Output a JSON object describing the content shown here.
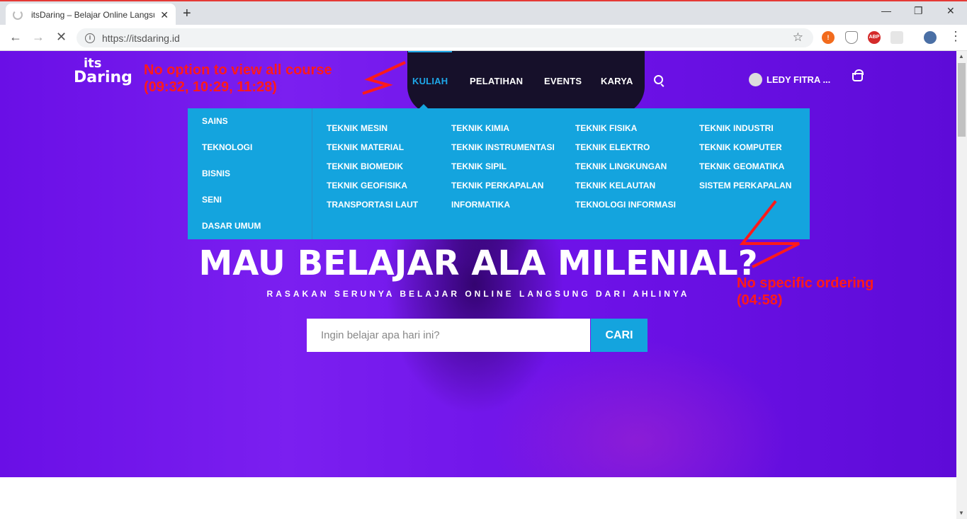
{
  "browser": {
    "tab_title": "itsDaring – Belajar Online Langsung",
    "url": "https://itsdaring.id",
    "new_tab": "+",
    "tab_close": "✕",
    "minimize": "—",
    "maximize": "❐",
    "close": "✕",
    "back": "←",
    "forward": "→",
    "stop": "✕",
    "star": "☆",
    "menu": "⋮",
    "ext_abp": "ABP",
    "ext_alert": "!"
  },
  "site": {
    "logo_line1": "its",
    "logo_line2": "Daring",
    "nav": [
      "KULIAH",
      "PELATIHAN",
      "EVENTS",
      "KARYA"
    ],
    "user_name": "LEDY FITRA ...",
    "categories": [
      "SAINS",
      "TEKNOLOGI",
      "BISNIS",
      "SENI",
      "DASAR UMUM"
    ],
    "subcategories": {
      "col1": [
        "TEKNIK MESIN",
        "TEKNIK MATERIAL",
        "TEKNIK BIOMEDIK",
        "TEKNIK GEOFISIKA",
        "TRANSPORTASI LAUT"
      ],
      "col2": [
        "TEKNIK KIMIA",
        "TEKNIK INSTRUMENTASI",
        "TEKNIK SIPIL",
        "TEKNIK PERKAPALAN",
        "INFORMATIKA"
      ],
      "col3": [
        "TEKNIK FISIKA",
        "TEKNIK ELEKTRO",
        "TEKNIK LINGKUNGAN",
        "TEKNIK KELAUTAN",
        "TEKNOLOGI INFORMASI"
      ],
      "col4": [
        "TEKNIK INDUSTRI",
        "TEKNIK KOMPUTER",
        "TEKNIK GEOMATIKA",
        "SISTEM PERKAPALAN"
      ]
    },
    "hero_title": "MAU BELAJAR ALA MILENIAL?",
    "hero_subtitle": "RASAKAN SERUNYA BELAJAR ONLINE LANGSUNG DARI AHLINYA",
    "search_placeholder": "Ingin belajar apa hari ini?",
    "search_button": "CARI"
  },
  "annotations": {
    "note1_line1": "No option to view all course",
    "note1_line2": "(09:32, 10:29, 11:28)",
    "note2_line1": "No specific ordering",
    "note2_line2": "(04:58)",
    "color": "#ff1a1a"
  },
  "colors": {
    "accent": "#14a4de",
    "hero": "#6a0fe6",
    "chrome_frame": "#dee1e6"
  }
}
